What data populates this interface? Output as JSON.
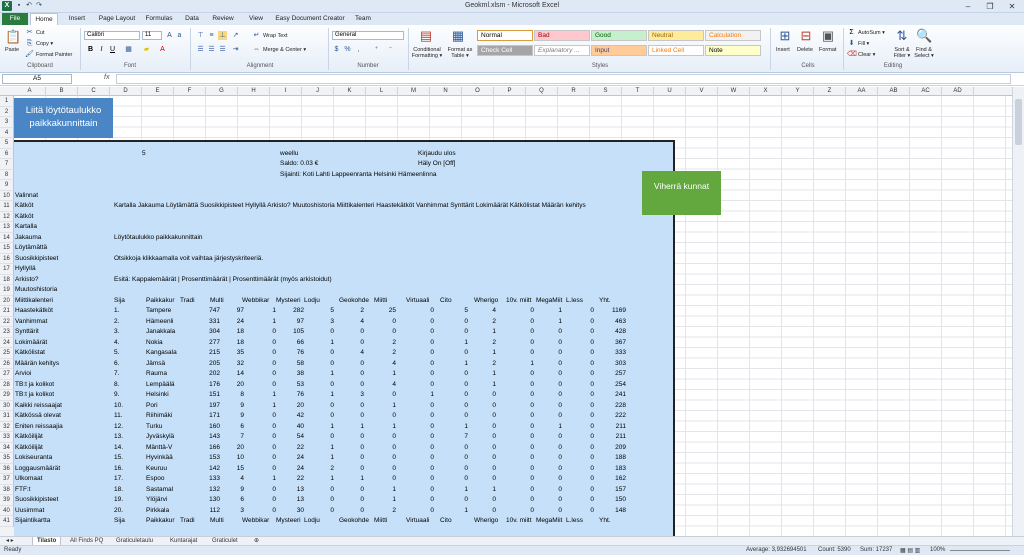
{
  "window": {
    "title": "Geokml.xlsm  -  Microsoft Excel"
  },
  "tabs": [
    "File",
    "Home",
    "Insert",
    "Page Layout",
    "Formulas",
    "Data",
    "Review",
    "View",
    "Easy Document Creator",
    "Team"
  ],
  "ribbon": {
    "clipboard": {
      "paste": "Paste",
      "cut": "Cut",
      "copy": "Copy ▾",
      "format_painter": "Format Painter",
      "label": "Clipboard"
    },
    "font": {
      "name": "Calibri",
      "size": "11",
      "label": "Font"
    },
    "alignment": {
      "wrap": "Wrap Text",
      "merge": "Merge & Center ▾",
      "label": "Alignment"
    },
    "number": {
      "format": "General",
      "label": "Number"
    },
    "styles": {
      "cond": "Conditional Formatting ▾",
      "table": "Format as Table ▾",
      "label": "Styles",
      "cells": [
        {
          "text": "Normal",
          "bg": "#ffffff",
          "fg": "#000000"
        },
        {
          "text": "Bad",
          "bg": "#ffc7ce",
          "fg": "#9c0006"
        },
        {
          "text": "Good",
          "bg": "#c6efce",
          "fg": "#006100"
        },
        {
          "text": "Neutral",
          "bg": "#ffeb9c",
          "fg": "#9c6500"
        },
        {
          "text": "Calculation",
          "bg": "#f2f2f2",
          "fg": "#fa7d00"
        },
        {
          "text": "Check Cell",
          "bg": "#a5a5a5",
          "fg": "#ffffff"
        },
        {
          "text": "Explanatory ...",
          "bg": "#ffffff",
          "fg": "#7f7f7f"
        },
        {
          "text": "Input",
          "bg": "#ffcc99",
          "fg": "#3f3f76"
        },
        {
          "text": "Linked Cell",
          "bg": "#ffffff",
          "fg": "#fa7d00"
        },
        {
          "text": "Note",
          "bg": "#ffffcc",
          "fg": "#000000"
        }
      ]
    },
    "cells": {
      "insert": "Insert",
      "delete": "Delete",
      "format": "Format",
      "label": "Cells"
    },
    "editing": {
      "autosum": "AutoSum ▾",
      "fill": "Fill ▾",
      "clear": "Clear ▾",
      "sort": "Sort & Filter ▾",
      "find": "Find & Select ▾",
      "label": "Editing"
    }
  },
  "formula_bar": {
    "name_box": "A5",
    "fx": "fx",
    "value": ""
  },
  "columns": [
    "A",
    "B",
    "C",
    "D",
    "E",
    "F",
    "G",
    "H",
    "I",
    "J",
    "K",
    "L",
    "M",
    "N",
    "O",
    "P",
    "Q",
    "R",
    "S",
    "T",
    "U",
    "V",
    "W",
    "X",
    "Y",
    "Z",
    "AA",
    "AB",
    "AC",
    "AD"
  ],
  "rows": [
    "1",
    "2",
    "3",
    "4",
    "5",
    "6",
    "7",
    "8",
    "9",
    "10",
    "11",
    "12",
    "13",
    "14",
    "15",
    "16",
    "17",
    "18",
    "19",
    "20",
    "21",
    "22",
    "23",
    "24",
    "25",
    "26",
    "27",
    "28",
    "29",
    "30",
    "31",
    "32",
    "33",
    "34",
    "35",
    "36",
    "37",
    "38",
    "39",
    "40",
    "41"
  ],
  "shapes": {
    "import_button": "Liitä löytötaulukko paikkakunnittain",
    "green_button": "Viherrä kunnat"
  },
  "header_info": {
    "count": "5",
    "user": "weellu",
    "balance": "Saldo: 0.03 €",
    "location": "Sijainti: Koti Lahti Lappeenranta Helsinki Hämeenlinna",
    "logout": "Kirjaudu ulos",
    "alarm": "Häly On [Off]"
  },
  "menu_col_a": [
    "Valinnat",
    "Kätköt",
    "Kätköt",
    "Kartalla",
    "Jakauma",
    "Löytämättä",
    "Suosikkipisteet",
    "Hyllyllä",
    "Arkisto?",
    "Muutoshistoria",
    "Miittikalenteri",
    "Haastekätköt",
    "Vanhimmat",
    "Synttärit",
    "Lokimäärät",
    "Kätkölistat",
    "Määrän kehitys",
    "Arvioi",
    "TB:t ja kolikot",
    "TB:t ja kolikot",
    "Kaikki reissaajat",
    "Kätkössä olevat",
    "Eniten reissaajia",
    "Kätköilijät",
    "Kätköilijät",
    "Lokiseuranta",
    "Loggausmäärät",
    "Ulkomaat",
    "FTF:t",
    "Suosikkipisteet",
    "Uusimmat",
    "Sijaintikartta"
  ],
  "nav_line": "Kartalla Jakauma Löytämättä Suosikkipisteet Hyllyllä Arkisto? Muutoshistoria Miittikalenteri Haastekätköt Vanhimmat Synttärit Lokimäärät Kätkölistat Määrän kehitys",
  "jakauma_line": "Löytötaulukko paikkakunnittain",
  "sort_hint": "Otsikkoja klikkaamalla voit vaihtaa järjestyskriteeriä.",
  "display_line": "Esitä: Kappalemäärät | Prosenttimäärät | Prosenttimäärät (myös arkistoidut)",
  "table": {
    "headers": [
      "Sija",
      "Paikkakur",
      "Tradi",
      "Multi",
      "Webbikar",
      "Mysteeri",
      "Lodju",
      "Geokohde",
      "Miitti",
      "Virtuaali",
      "Cito",
      "Wherigo",
      "10v. miitt",
      "MegaMiit",
      "L.less",
      "Yht."
    ],
    "rows": [
      [
        "1.",
        "Tampere",
        "747",
        "97",
        "1",
        "282",
        "5",
        "2",
        "25",
        "0",
        "5",
        "4",
        "0",
        "1",
        "0",
        "1169"
      ],
      [
        "2.",
        "Hämeenli",
        "331",
        "24",
        "1",
        "97",
        "3",
        "4",
        "0",
        "0",
        "0",
        "2",
        "0",
        "1",
        "0",
        "463"
      ],
      [
        "3.",
        "Janakkala",
        "304",
        "18",
        "0",
        "105",
        "0",
        "0",
        "0",
        "0",
        "0",
        "1",
        "0",
        "0",
        "0",
        "428"
      ],
      [
        "4.",
        "Nokia",
        "277",
        "18",
        "0",
        "66",
        "1",
        "0",
        "2",
        "0",
        "1",
        "2",
        "0",
        "0",
        "0",
        "367"
      ],
      [
        "5.",
        "Kangasala",
        "215",
        "35",
        "0",
        "76",
        "0",
        "4",
        "2",
        "0",
        "0",
        "1",
        "0",
        "0",
        "0",
        "333"
      ],
      [
        "6.",
        "Jämsä",
        "205",
        "32",
        "0",
        "58",
        "0",
        "0",
        "4",
        "0",
        "1",
        "2",
        "1",
        "0",
        "0",
        "303"
      ],
      [
        "7.",
        "Rauma",
        "202",
        "14",
        "0",
        "38",
        "1",
        "0",
        "1",
        "0",
        "0",
        "1",
        "0",
        "0",
        "0",
        "257"
      ],
      [
        "8.",
        "Lempäälä",
        "176",
        "20",
        "0",
        "53",
        "0",
        "0",
        "4",
        "0",
        "0",
        "1",
        "0",
        "0",
        "0",
        "254"
      ],
      [
        "9.",
        "Helsinki",
        "151",
        "8",
        "1",
        "76",
        "1",
        "3",
        "0",
        "1",
        "0",
        "0",
        "0",
        "0",
        "0",
        "241"
      ],
      [
        "10.",
        "Pori",
        "197",
        "9",
        "1",
        "20",
        "0",
        "0",
        "1",
        "0",
        "0",
        "0",
        "0",
        "0",
        "0",
        "228"
      ],
      [
        "11.",
        "Riihimäki",
        "171",
        "9",
        "0",
        "42",
        "0",
        "0",
        "0",
        "0",
        "0",
        "0",
        "0",
        "0",
        "0",
        "222"
      ],
      [
        "12.",
        "Turku",
        "160",
        "6",
        "0",
        "40",
        "1",
        "1",
        "1",
        "0",
        "1",
        "0",
        "0",
        "1",
        "0",
        "211"
      ],
      [
        "13.",
        "Jyväskylä",
        "143",
        "7",
        "0",
        "54",
        "0",
        "0",
        "0",
        "0",
        "7",
        "0",
        "0",
        "0",
        "0",
        "211"
      ],
      [
        "14.",
        "Mänttä-V",
        "166",
        "20",
        "0",
        "22",
        "1",
        "0",
        "0",
        "0",
        "0",
        "0",
        "0",
        "0",
        "0",
        "209"
      ],
      [
        "15.",
        "Hyvinkää",
        "153",
        "10",
        "0",
        "24",
        "1",
        "0",
        "0",
        "0",
        "0",
        "0",
        "0",
        "0",
        "0",
        "188"
      ],
      [
        "16.",
        "Keuruu",
        "142",
        "15",
        "0",
        "24",
        "2",
        "0",
        "0",
        "0",
        "0",
        "0",
        "0",
        "0",
        "0",
        "183"
      ],
      [
        "17.",
        "Espoo",
        "133",
        "4",
        "1",
        "22",
        "1",
        "1",
        "0",
        "0",
        "0",
        "0",
        "0",
        "0",
        "0",
        "162"
      ],
      [
        "18.",
        "Sastamal",
        "132",
        "9",
        "0",
        "13",
        "0",
        "0",
        "1",
        "0",
        "1",
        "1",
        "0",
        "0",
        "0",
        "157"
      ],
      [
        "19.",
        "Ylöjärvi",
        "130",
        "6",
        "0",
        "13",
        "0",
        "0",
        "1",
        "0",
        "0",
        "0",
        "0",
        "0",
        "0",
        "150"
      ],
      [
        "20.",
        "Pirkkala",
        "112",
        "3",
        "0",
        "30",
        "0",
        "0",
        "2",
        "0",
        "1",
        "0",
        "0",
        "0",
        "0",
        "148"
      ]
    ]
  },
  "sheet_tabs": [
    "Tilasto",
    "All Finds PQ",
    "Graticuletaulu",
    "Kuntarajat",
    "Graticulet"
  ],
  "status": {
    "ready": "Ready",
    "average": "Average: 3,932694501",
    "count": "Count: 5390",
    "sum": "Sum: 17237",
    "zoom": "100%"
  }
}
